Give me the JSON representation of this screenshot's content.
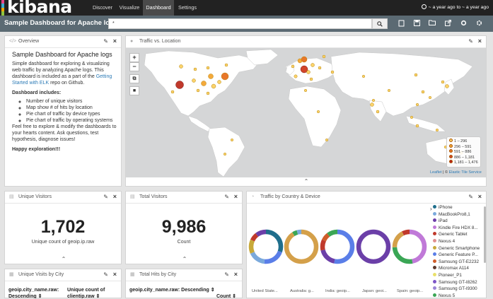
{
  "app": {
    "logo_text": "kibana",
    "logo_colors": [
      "#e8478b",
      "#3caed2",
      "#f5a700",
      "#90c53f"
    ]
  },
  "nav": {
    "tabs": [
      "Discover",
      "Visualize",
      "Dashboard",
      "Settings"
    ],
    "active": "Dashboard"
  },
  "time": {
    "label": "~ a year ago to ~ a year ago"
  },
  "dashboard": {
    "title": "Sample Dashboard for Apache logs",
    "query": "*"
  },
  "toolbar": {
    "icons": [
      "new-dashboard-icon",
      "save-icon",
      "open-icon",
      "share-icon",
      "options-icon",
      "settings-icon"
    ]
  },
  "panels": {
    "overview": {
      "title": "Overview",
      "heading": "Sample Dashboard for Apache logs",
      "intro": "Simple dashboard for exploring & visualizing web traffic by analyzing Apache logs. This dashboard is included as a part of the ",
      "link": "Getting Started with ELK",
      "intro_end": " repo on Github.",
      "includes_label": "Dashboard includes:",
      "bullets": [
        "Number of unique visitors",
        "Map show # of hits by location",
        "Pie chart of traffic by device types",
        "Pie chart of traffic by operating systems"
      ],
      "closing": "Feel free to explore & modify the dashboards to your hearts content. Ask questions, test hypothesis, diagnose issues!",
      "happy": "Happy exploration!!!"
    },
    "map": {
      "title": "Traffic vs. Location",
      "legend": [
        "1 – 296",
        "296 – 591",
        "591 – 886",
        "886 – 1,181",
        "1,181 – 1,476"
      ],
      "legend_colors": [
        "#fbd36b",
        "#f4a93b",
        "#e8772a",
        "#d2452a",
        "#b81c1c"
      ],
      "attribution_link1": "Leaflet",
      "attribution_sep": " | © ",
      "attribution_link2": "Elastic Tile Service",
      "zoom_in": "+",
      "zoom_out": "−"
    },
    "unique_visitors": {
      "title": "Unique Visitors",
      "value": "1,702",
      "label": "Unique count of geoip.ip.raw"
    },
    "total_visitors": {
      "title": "Total Visitors",
      "value": "9,986",
      "label": "Count"
    },
    "traffic": {
      "title": "Traffic by Country & Device",
      "donut_labels": [
        "United State...",
        "Australia: g...",
        "India: geoip...",
        "Japan: geoi...",
        "Spain: geoip..."
      ],
      "legend": [
        {
          "name": "iPhone",
          "color": "#1f6e8c"
        },
        {
          "name": "MacBookPro8,1",
          "color": "#7aa9dc"
        },
        {
          "name": "iPad",
          "color": "#6b3fa8"
        },
        {
          "name": "Kindle Fire HDX 8...",
          "color": "#c079d8"
        },
        {
          "name": "Generic Tablet",
          "color": "#c0392b"
        },
        {
          "name": "Nexus 4",
          "color": "#e08f8f"
        },
        {
          "name": "Generic Smartphone",
          "color": "#c8a93a"
        },
        {
          "name": "Generic Feature P...",
          "color": "#5a7ee8"
        },
        {
          "name": "Samsung GT-E2232",
          "color": "#d05d2a"
        },
        {
          "name": "Micromax A114",
          "color": "#5c3a2e"
        },
        {
          "name": "Pioneer_P1",
          "color": "#e9e06a"
        },
        {
          "name": "Samsung GT-I8262",
          "color": "#7d55c7"
        },
        {
          "name": "Samsung GT-I9300",
          "color": "#9b86d6"
        },
        {
          "name": "Nexus 5",
          "color": "#3aa655"
        }
      ]
    },
    "visits_city": {
      "title": "Unique Visits by City",
      "col1": "geoip.city_name.raw: Descending ⇕",
      "col2": "Unique count of clientip.raw ⇕"
    },
    "hits_city": {
      "title": "Total Hits by City",
      "col1": "geoip.city_name.raw: Descending ⇕",
      "col2": "Count ⇕"
    }
  }
}
